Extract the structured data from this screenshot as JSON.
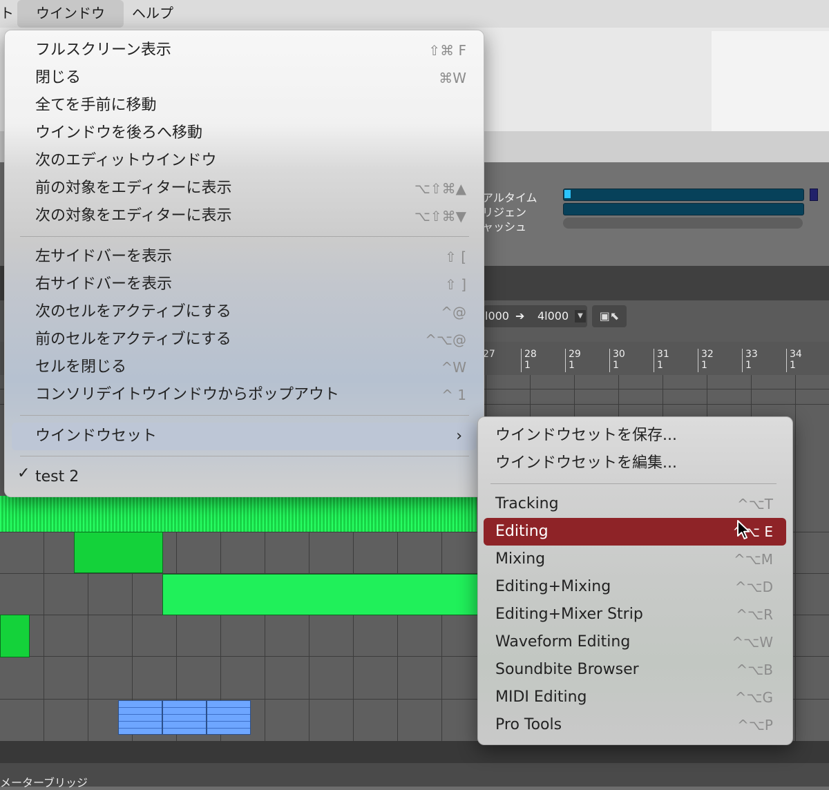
{
  "menubar": {
    "items": [
      {
        "label": "ト"
      },
      {
        "label": "ウインドウ"
      },
      {
        "label": "ヘルプ"
      }
    ]
  },
  "background": {
    "meters": {
      "labels": [
        "アルタイム",
        "リジェン",
        "ャッシュ"
      ]
    },
    "counter": {
      "start": "l000",
      "end": "4l000"
    },
    "ruler_bars": [
      {
        "bar": "27",
        "beat": ""
      },
      {
        "bar": "28",
        "beat": "1"
      },
      {
        "bar": "29",
        "beat": "1"
      },
      {
        "bar": "30",
        "beat": "1"
      },
      {
        "bar": "31",
        "beat": "1"
      },
      {
        "bar": "32",
        "beat": "1"
      },
      {
        "bar": "33",
        "beat": "1"
      },
      {
        "bar": "34",
        "beat": "1"
      }
    ],
    "bottom_label": "メーターブリッジ"
  },
  "window_menu": {
    "items": [
      {
        "label": "フルスクリーン表示",
        "shortcut": "⇧⌘ F"
      },
      {
        "label": "閉じる",
        "shortcut": "⌘W"
      },
      {
        "label": "全てを手前に移動",
        "shortcut": ""
      },
      {
        "label": "ウインドウを後ろへ移動",
        "shortcut": ""
      },
      {
        "label": "次のエディットウインドウ",
        "shortcut": ""
      },
      {
        "label": "前の対象をエディターに表示",
        "shortcut": "⌥⇧⌘▲"
      },
      {
        "label": "次の対象をエディターに表示",
        "shortcut": "⌥⇧⌘▼"
      },
      {
        "label": "左サイドバーを表示",
        "shortcut": "⇧ ["
      },
      {
        "label": "右サイドバーを表示",
        "shortcut": "⇧ ]"
      },
      {
        "label": "次のセルをアクティブにする",
        "shortcut": "^@"
      },
      {
        "label": "前のセルをアクティブにする",
        "shortcut": "^⌥@"
      },
      {
        "label": "セルを閉じる",
        "shortcut": "^W"
      },
      {
        "label": "コンソリデイトウインドウからポップアウト",
        "shortcut": "^ 1"
      }
    ],
    "window_set_label": "ウインドウセット",
    "check_item": {
      "check": "✓",
      "label": "test 2"
    }
  },
  "window_set_submenu": {
    "actions": [
      {
        "label": "ウインドウセットを保存..."
      },
      {
        "label": "ウインドウセットを編集..."
      }
    ],
    "sets": [
      {
        "label": "Tracking",
        "shortcut": "^⌥T"
      },
      {
        "label": "Editing",
        "shortcut": "^⌥ E"
      },
      {
        "label": "Mixing",
        "shortcut": "^⌥M"
      },
      {
        "label": "Editing+Mixing",
        "shortcut": "^⌥D"
      },
      {
        "label": "Editing+Mixer Strip",
        "shortcut": "^⌥R"
      },
      {
        "label": "Waveform Editing",
        "shortcut": "^⌥W"
      },
      {
        "label": "Soundbite Browser",
        "shortcut": "^⌥B"
      },
      {
        "label": "MIDI Editing",
        "shortcut": "^⌥G"
      },
      {
        "label": "Pro Tools",
        "shortcut": "^⌥P"
      }
    ],
    "highlight_color": "#8e2327"
  }
}
